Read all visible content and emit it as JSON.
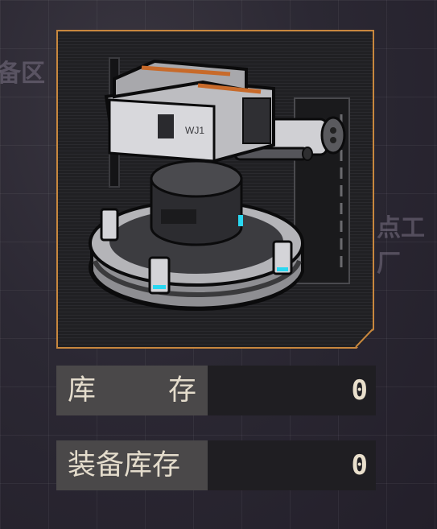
{
  "background": {
    "left_text": "备区",
    "right_text": "点工厂"
  },
  "item": {
    "name": "turret-artwork",
    "colors": {
      "frame": "#c8873e",
      "accent": "#2ad7f0",
      "stripe": "#c86a2a"
    },
    "turret_marking": "WJ1"
  },
  "stats": {
    "inventory_label_1": "库",
    "inventory_label_2": "存",
    "inventory_value": "0",
    "equipped_label": "装备库存",
    "equipped_value": "0"
  }
}
